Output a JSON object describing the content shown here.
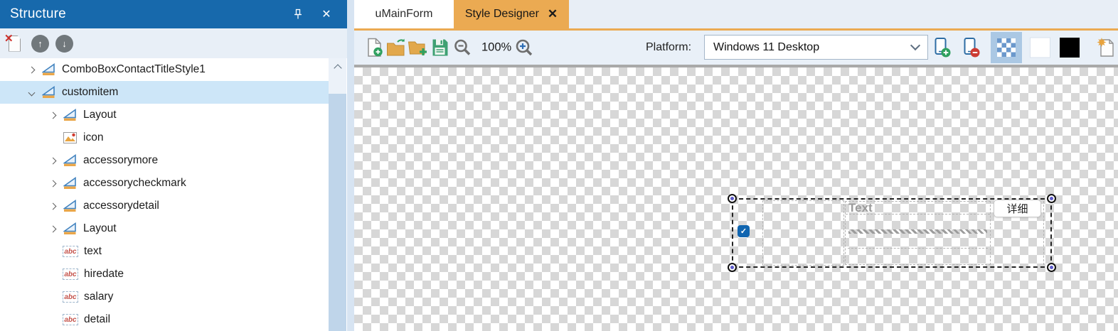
{
  "colors": {
    "header_blue": "#1769ac",
    "selected_row_blue": "#cde6f8",
    "active_tab_orange": "#ebaa52",
    "checkbox_blue": "#1065b0",
    "handle_dot_violet": "#5b59c9",
    "folder_orange": "#e2a84c",
    "save_green": "#3fa173",
    "add_green": "#2fa05f",
    "remove_red": "#cc3b33",
    "checker_gray": "#d7d7d7"
  },
  "icons": {
    "close_glyph": "✕",
    "check_glyph": "✓",
    "delete_x_glyph": "✕",
    "abc_glyph": "abc",
    "up_arrow_glyph": "↑",
    "down_arrow_glyph": "↓"
  },
  "structure_panel": {
    "title": "Structure",
    "toolbar_icons": [
      "delete-item",
      "move-up",
      "move-down"
    ],
    "tree": [
      {
        "label": "ComboBoxContactTitleStyle1",
        "depth": 0,
        "expander": "collapsed",
        "icon": "style",
        "selected": false
      },
      {
        "label": "customitem",
        "depth": 0,
        "expander": "expanded",
        "icon": "style",
        "selected": true
      },
      {
        "label": "Layout",
        "depth": 1,
        "expander": "collapsed",
        "icon": "style",
        "selected": false
      },
      {
        "label": "icon",
        "depth": 1,
        "expander": "none",
        "icon": "image",
        "selected": false
      },
      {
        "label": "accessorymore",
        "depth": 1,
        "expander": "collapsed",
        "icon": "style",
        "selected": false
      },
      {
        "label": "accessorycheckmark",
        "depth": 1,
        "expander": "collapsed",
        "icon": "style",
        "selected": false
      },
      {
        "label": "accessorydetail",
        "depth": 1,
        "expander": "collapsed",
        "icon": "style",
        "selected": false
      },
      {
        "label": "Layout",
        "depth": 1,
        "expander": "collapsed",
        "icon": "style",
        "selected": false
      },
      {
        "label": "text",
        "depth": 1,
        "expander": "none",
        "icon": "abc",
        "selected": false
      },
      {
        "label": "hiredate",
        "depth": 1,
        "expander": "none",
        "icon": "abc",
        "selected": false
      },
      {
        "label": "salary",
        "depth": 1,
        "expander": "none",
        "icon": "abc",
        "selected": false
      },
      {
        "label": "detail",
        "depth": 1,
        "expander": "none",
        "icon": "abc",
        "selected": false
      }
    ]
  },
  "editor": {
    "tabs": [
      {
        "label": "uMainForm",
        "active": false
      },
      {
        "label": "Style Designer",
        "active": true
      }
    ],
    "toolbar": {
      "left_icons": [
        "new-document",
        "open-file",
        "add-folder",
        "save",
        "zoom-out",
        "zoom-in"
      ],
      "zoom_level": "100%",
      "platform_label": "Platform:",
      "platform_value": "Windows 11 Desktop",
      "right_icons": [
        "add-platform-view",
        "remove-platform-view",
        "transparent-background",
        "white-background",
        "black-background",
        "new-style"
      ]
    },
    "canvas": {
      "style_item": {
        "checkbox_checked": true,
        "text_placeholder": "Text",
        "detail_button_label": "详细"
      }
    }
  }
}
